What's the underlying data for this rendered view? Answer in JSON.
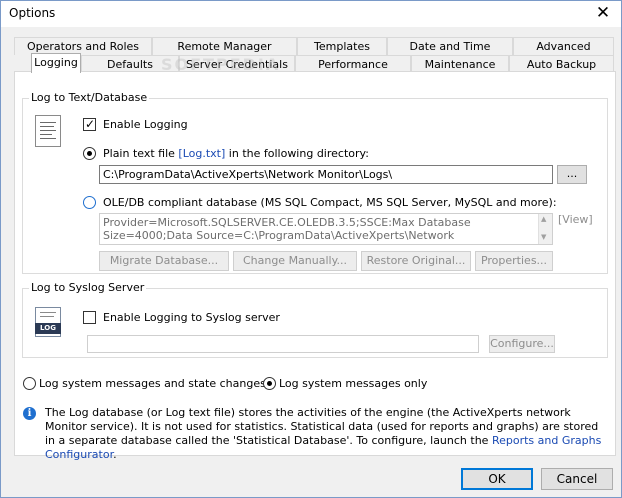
{
  "window": {
    "title": "Options",
    "close_glyph": "✕"
  },
  "tabs_row1": [
    "Operators and Roles",
    "Remote Manager",
    "Templates",
    "Date and Time",
    "Advanced"
  ],
  "tabs_row2": [
    "Logging",
    "Defaults",
    "Server Credentials",
    "Performance",
    "Maintenance",
    "Auto Backup"
  ],
  "selected_tab": "Logging",
  "watermark": "SOFTPEDIA",
  "log_text_db": {
    "group_title": "Log to Text/Database",
    "enable_logging_label": "Enable Logging",
    "enable_logging_checked": true,
    "plain_text_label_pre": "Plain text file",
    "plain_text_link": "[Log.txt]",
    "plain_text_label_post": "in the following directory:",
    "plain_text_selected": true,
    "directory_value": "C:\\ProgramData\\ActiveXperts\\Network Monitor\\Logs\\",
    "browse_label": "...",
    "oledb_label": "OLE/DB compliant database (MS SQL Compact, MS SQL Server, MySQL and more):",
    "connection_string": "Provider=Microsoft.SQLSERVER.CE.OLEDB.3.5;SSCE:Max Database Size=4000;Data Source=C:\\ProgramData\\ActiveXperts\\Network Monitor\\Logs\\Log.sdf",
    "view_label": "[View]",
    "buttons": [
      "Migrate Database...",
      "Change Manually...",
      "Restore Original...",
      "Properties..."
    ]
  },
  "syslog": {
    "group_title": "Log to Syslog Server",
    "enable_label": "Enable Logging  to Syslog server",
    "enable_checked": false,
    "icon_text": "LOG",
    "server_value": "",
    "configure_label": "Configure..."
  },
  "log_mode": {
    "option_all": "Log system messages and state changes",
    "option_only": "Log system messages only",
    "selected": "only"
  },
  "info": {
    "text_part1": "The Log database (or Log text file) stores the activities of the engine (the ActiveXperts network Monitor service). It is not used for statistics. Statistical data (used for reports and graphs) are stored in a separate database called the 'Statistical Database'. To configure, launch the ",
    "link": "Reports and Graphs Configurator",
    "text_part2": "."
  },
  "footer": {
    "ok_label": "OK",
    "cancel_label": "Cancel"
  }
}
